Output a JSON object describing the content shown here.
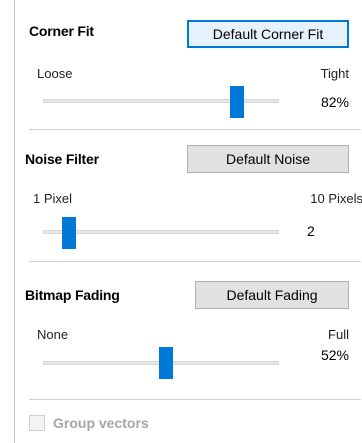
{
  "corner_fit": {
    "title": "Corner Fit",
    "default_button": "Default Corner Fit",
    "min_label": "Loose",
    "max_label": "Tight",
    "value_text": "82%",
    "value_fraction": 0.82
  },
  "noise_filter": {
    "title": "Noise Filter",
    "default_button": "Default Noise",
    "min_label": "1 Pixel",
    "max_label": "10 Pixels",
    "value_text": "2",
    "value_fraction": 0.111
  },
  "bitmap_fading": {
    "title": "Bitmap Fading",
    "default_button": "Default Fading",
    "min_label": "None",
    "max_label": "Full",
    "value_text": "52%",
    "value_fraction": 0.52
  },
  "group_vectors": {
    "label": "Group vectors",
    "checked": false,
    "enabled": false
  },
  "colors": {
    "accent": "#0078d7",
    "disabled_text": "#a6a6a6"
  }
}
